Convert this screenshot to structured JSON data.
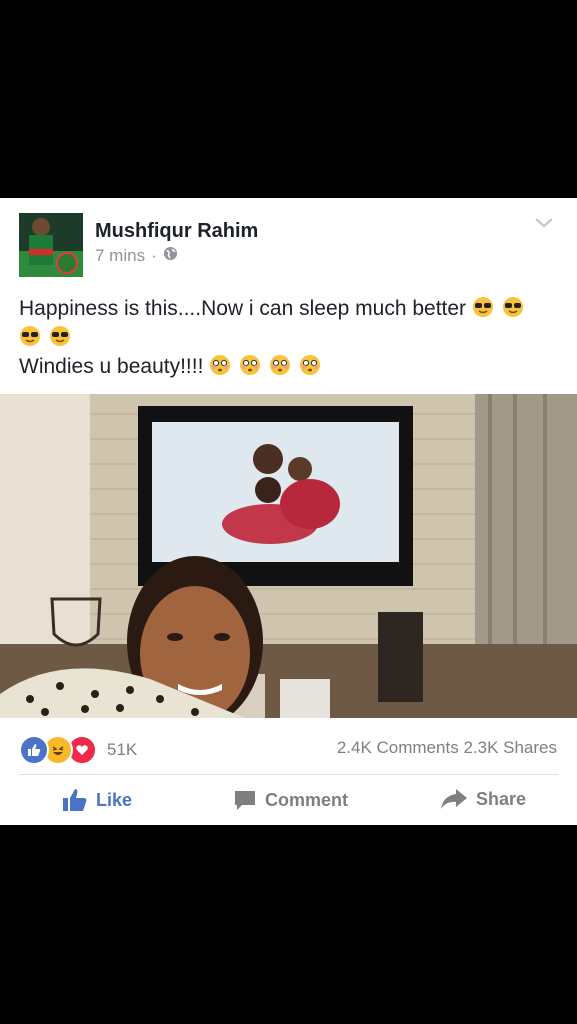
{
  "post": {
    "author": "Mushfiqur Rahim",
    "time": "7 mins",
    "separator": "·",
    "text_line1": "Happiness is this....Now i can sleep much better",
    "text_line3": "Windies u beauty!!!!"
  },
  "reactions": {
    "count": "51K",
    "comments": "2.4K Comments",
    "shares": "2.3K Shares"
  },
  "actions": {
    "like": "Like",
    "comment": "Comment",
    "share": "Share"
  },
  "colors": {
    "like_blue": "#4b74c9",
    "love_red": "#f0284a",
    "haha_yellow": "#f7b928"
  },
  "icons": [
    "globe-icon",
    "chevron-down-icon",
    "like-icon",
    "haha-icon",
    "love-icon",
    "comment-icon",
    "share-icon",
    "sunglasses-emoji",
    "flushed-emoji"
  ]
}
